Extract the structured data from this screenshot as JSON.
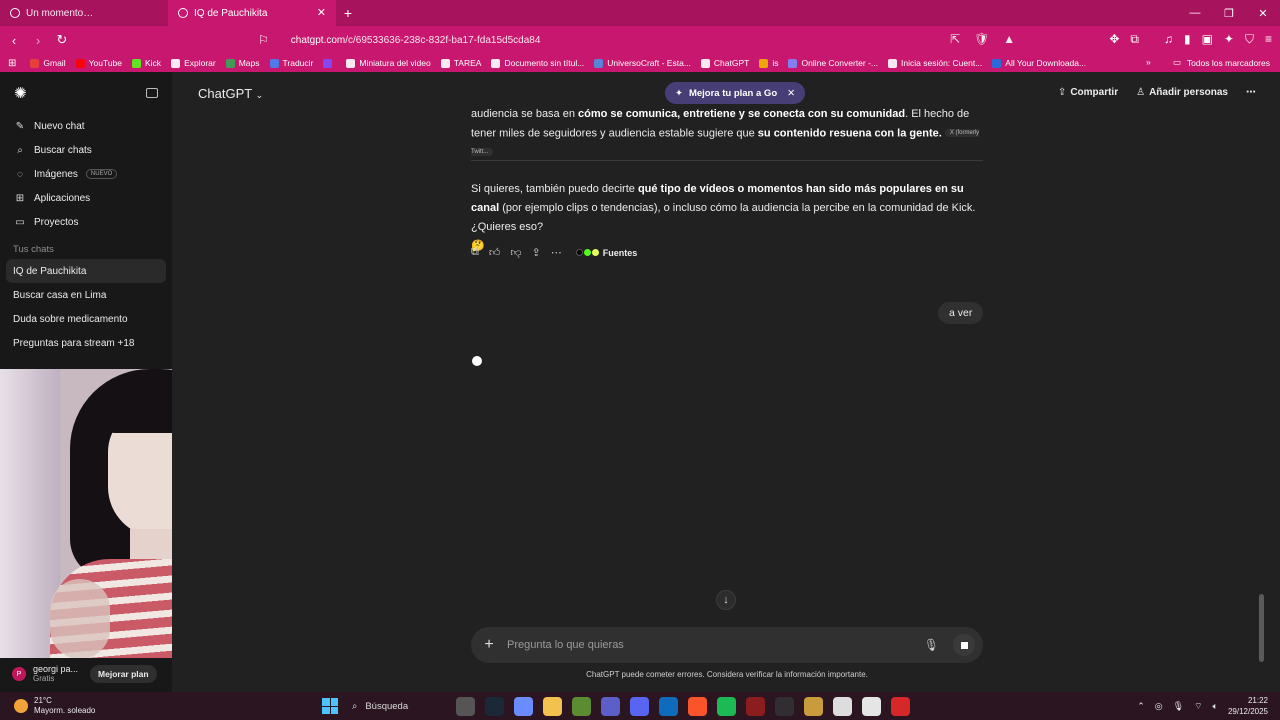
{
  "browser": {
    "tabs": [
      {
        "label": "Un momento…",
        "active": false
      },
      {
        "label": "IQ de Pauchikita",
        "active": true
      }
    ],
    "url_host": "chatgpt.com",
    "url_path": "/c/69533636-238c-832f-ba17-fda15d5cda84",
    "bookmarks": [
      "Gmail",
      "YouTube",
      "Kick",
      "Explorar",
      "Maps",
      "Traducir",
      "",
      "Miniatura del video",
      "TAREA",
      "Documento sin títul...",
      "UniversoCraft - Esta...",
      "ChatGPT",
      "is",
      "Online Converter -...",
      "Inicia sesión: Cuent...",
      "All Your Downloada..."
    ],
    "all_bookmarks": "Todos los marcadores",
    "bookmark_colors": [
      "#ea4335",
      "#ff0000",
      "#53fc18",
      "#ffffff",
      "#34a853",
      "#4285f4",
      "#7c4dff",
      "#ffffff",
      "#ffffff",
      "#ffffff",
      "#4a90e2",
      "#ffffff",
      "#f4b400",
      "#7c8bff",
      "#ffffff",
      "#1a73e8"
    ]
  },
  "sidebar": {
    "items": [
      {
        "label": "Nuevo chat",
        "icon": "edit-icon",
        "glyph": "✎"
      },
      {
        "label": "Buscar chats",
        "icon": "search-icon",
        "glyph": "⌕"
      },
      {
        "label": "Imágenes",
        "icon": "image-icon",
        "glyph": "◌",
        "badge": "NUEVO"
      },
      {
        "label": "Aplicaciones",
        "icon": "apps-icon",
        "glyph": "⊞"
      },
      {
        "label": "Proyectos",
        "icon": "folder-icon",
        "glyph": "▭"
      }
    ],
    "section_title": "Tus chats",
    "chats": [
      "IQ de Pauchikita",
      "Buscar casa en Lima",
      "Duda sobre medicamento",
      "Preguntas para stream +18"
    ],
    "user_initial": "P",
    "user_name": "georgi pa...",
    "user_plan": "Gratis",
    "upgrade_label": "Mejorar plan"
  },
  "header": {
    "model": "ChatGPT",
    "upgrade_pill": "Mejora tu plan a Go",
    "share": "Compartir",
    "add_people": "Añadir personas"
  },
  "conversation": {
    "para1_a": "audiencia se basa en ",
    "para1_b": "cómo se comunica, entretiene y se conecta con su comunidad",
    "para1_c": ". El hecho de tener miles de seguidores y audiencia estable sugiere que ",
    "para1_d": "su contenido resuena con la gente.",
    "para1_chip": "X (formerly Twitt...",
    "para2_a": "Si quieres, también puedo decirte ",
    "para2_b": "qué tipo de vídeos o momentos han sido más populares en su canal",
    "para2_c": " (por ejemplo clips o tendencias), o incluso cómo la audiencia la percibe en la comunidad de Kick. ¿Quieres eso?",
    "para2_emoji": "🤔",
    "sources_label": "Fuentes",
    "user_message": "a ver"
  },
  "composer": {
    "placeholder": "Pregunta lo que quieras",
    "disclaimer": "ChatGPT puede cometer errores. Considera verificar la información importante."
  },
  "taskbar": {
    "temperature": "21°C",
    "weather": "Mayorm. soleado",
    "search": "Búsqueda",
    "time": "21:22",
    "date": "29/12/2025",
    "apps": [
      {
        "name": "file-icon",
        "color": "#555555"
      },
      {
        "name": "steam-icon",
        "color": "#1b2838"
      },
      {
        "name": "copilot-icon",
        "color": "#6b8cff"
      },
      {
        "name": "explorer-icon",
        "color": "#f2c14e"
      },
      {
        "name": "minecraft-icon",
        "color": "#5b8c32"
      },
      {
        "name": "teams-icon",
        "color": "#5b5fc7"
      },
      {
        "name": "discord-icon",
        "color": "#5865f2"
      },
      {
        "name": "mail-icon",
        "color": "#0f6cbd"
      },
      {
        "name": "brave-icon",
        "color": "#fb542b"
      },
      {
        "name": "spotify-icon",
        "color": "#1db954"
      },
      {
        "name": "app-red-icon",
        "color": "#8b1d1d"
      },
      {
        "name": "obs-icon",
        "color": "#302e31"
      },
      {
        "name": "league-icon",
        "color": "#c89b3c"
      },
      {
        "name": "app-white-icon",
        "color": "#dddddd"
      },
      {
        "name": "app-cat-icon",
        "color": "#e5e5e5"
      },
      {
        "name": "app-redbox-icon",
        "color": "#d62828"
      }
    ]
  }
}
